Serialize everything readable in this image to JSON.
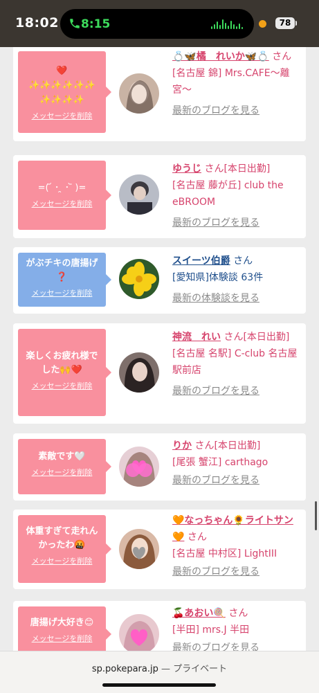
{
  "status_bar": {
    "time": "18:02",
    "call_time": "8:15",
    "battery": "78"
  },
  "colors": {
    "pink_bubble": "#f9909e",
    "blue_bubble": "#84aee8",
    "name_pink": "#d6436c",
    "name_blue": "#1f4f8c"
  },
  "delete_label": "メッセージを削除",
  "cards": [
    {
      "message": "❤️\n✨✨✨✨✨✨\n✨✨✨✨",
      "name": "💍🦋橘　れいか🦋💍",
      "san": "さん",
      "shop": "[名古屋 錦] Mrs.CAFE〜離宮〜",
      "link": "最新のブログを見る",
      "bubble": "pink"
    },
    {
      "message": "=( ᷄ ･ ̯ ･ ᷅ )=",
      "name": "ゆうじ",
      "san": "さん[本日出勤]",
      "shop": "[名古屋 藤が丘] club the eBROOM",
      "link": "最新のブログを見る",
      "bubble": "pink"
    },
    {
      "message": "がぶチキの唐揚げ❓",
      "name": "スイーツ伯爵",
      "san": "さん",
      "shop": "[愛知県]体験談 63件",
      "link": "最新の体験談を見る",
      "bubble": "blue"
    },
    {
      "message": "楽しくお疲れ様でした🙌❤️",
      "name": "神流　れい",
      "san": "さん[本日出勤]",
      "shop": "[名古屋 名駅] C-club 名古屋駅前店",
      "link": "最新のブログを見る",
      "bubble": "pink"
    },
    {
      "message": "素敵です🤍",
      "name": "りか",
      "san": "さん[本日出勤]",
      "shop": "[尾張 蟹江] carthago",
      "link": "最新のブログを見る",
      "bubble": "pink"
    },
    {
      "message": "体重すぎて走れんかったわ🤬",
      "name": "🧡なっちゃん🌻ライトサン🧡",
      "san": "さん",
      "shop": "[名古屋 中村区] LightIII",
      "link": "最新のブログを見る",
      "bubble": "pink"
    },
    {
      "message": "唐揚げ大好き😊",
      "name": "🍒あおい🍭",
      "san": "さん",
      "shop": "[半田] mrs.J 半田",
      "link": "最新のブログを見る",
      "bubble": "pink"
    }
  ],
  "address_bar": {
    "domain": "sp.pokepara.jp",
    "suffix": " — プライベート"
  }
}
